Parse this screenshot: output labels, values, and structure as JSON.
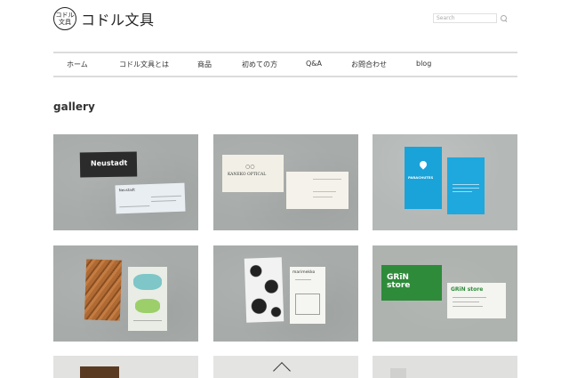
{
  "header": {
    "logo_mark_top": "コドル",
    "logo_mark_bottom": "文具",
    "logo_text": "コドル文具",
    "search_placeholder": "Search"
  },
  "nav": {
    "items": [
      {
        "label": "ホーム"
      },
      {
        "label": "コドル文具とは"
      },
      {
        "label": "商品"
      },
      {
        "label": "初めての方"
      },
      {
        "label": "Q&A"
      },
      {
        "label": "お問合わせ"
      },
      {
        "label": "blog"
      }
    ]
  },
  "page_title": "gallery",
  "gallery": {
    "items": [
      {
        "card_text": "Neustadt",
        "card_text_2": "Neustadt"
      },
      {
        "card_text": "KANEKO OPTICAL"
      },
      {
        "card_text": "PARACHUTES"
      },
      {
        "card_text": ""
      },
      {
        "card_text": "marimekko"
      },
      {
        "card_text": "GRīN store",
        "card_text_2": "GRīN store"
      }
    ]
  },
  "colors": {
    "green_card": "#2e8b3a",
    "blue_card": "#1aa3d9",
    "wood": "#b06a33",
    "concrete": "#a7aba9"
  }
}
